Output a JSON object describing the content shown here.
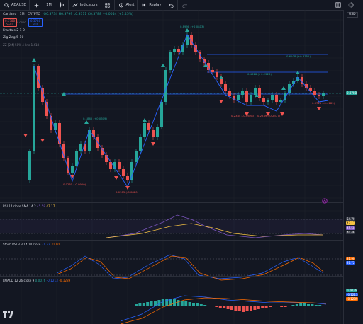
{
  "toolbar": {
    "symbol": "ADAUSD",
    "timeframe": "1M",
    "indicators_label": "Indicators",
    "alert_label": "Alert",
    "replay_label": "Replay"
  },
  "legend": {
    "title": "Cardano · 1M · CRYPTO",
    "ohlc": "O0.3734 H0.3799 L0.3711 C0.3788 +0.0054 (+1.45%)",
    "sell_price": "0.3788",
    "sell_label": "SELL",
    "buy_price": "0.3788",
    "buy_label": "BUY",
    "spread": "0.0000",
    "fractals": "Fractals 2 1 0",
    "zigzag": "Zig Zag 5 10",
    "zz_extra": "ZZ [2M] 50% 4 line 1.418"
  },
  "price_axis": {
    "currency": "USD",
    "last_price": "0.3788"
  },
  "annotations": [
    {
      "text": "0.8998 (+2.0813)"
    },
    {
      "text": "0.6108 (+0.3751)"
    },
    {
      "text": "0.4628 (+0.2226)"
    },
    {
      "text": "0.1865 (+0.0609)"
    },
    {
      "text": "0.2384 (-0.0628)"
    },
    {
      "text": "0.2249 (-0.2377)"
    },
    {
      "text": "0.3711 (-0.4189)"
    },
    {
      "text": "0.0255 (-0.0900)"
    },
    {
      "text": "0.0185 (-0.0880)"
    }
  ],
  "rsi": {
    "legend": "RSI 14 close SMA 14 2",
    "v1": "45.58",
    "v2": "47.17",
    "axis_top": "54.70",
    "axis_mid": "47.17",
    "axis_v1": "45.58",
    "axis_low": "40.46",
    "color_rsi": "#7e57c2",
    "color_ma": "#f5c243"
  },
  "stoch": {
    "legend": "Stoch RSI 3 3 14 14 close",
    "k": "31.72",
    "d": "31.90",
    "color_k": "#2962ff",
    "color_d": "#ff6d00"
  },
  "macd": {
    "legend": "LMACD 12 26 close 9",
    "v1": "0.0076",
    "v2": "-0.1213",
    "v3": "-0.1289",
    "color_macd": "#2962ff",
    "color_signal": "#ff6d00",
    "hist_pos": "#26a69a",
    "hist_neg": "#ef5350"
  },
  "colors": {
    "up": "#26a69a",
    "down": "#ef5350",
    "zigzag": "#2962ff",
    "background": "#131722"
  }
}
